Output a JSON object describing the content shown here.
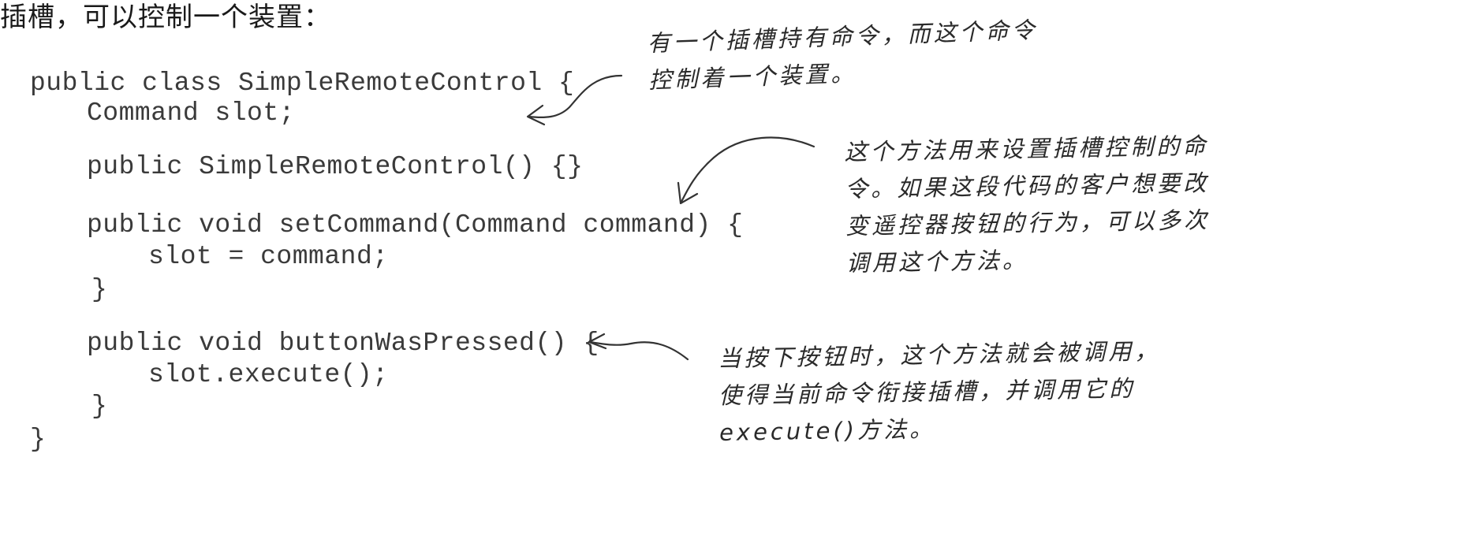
{
  "intro_text": "插槽，可以控制一个装置：",
  "code": {
    "line1": "public class SimpleRemoteControl {",
    "line2": "Command slot;",
    "line3": "public SimpleRemoteControl() {}",
    "line4": "public void setCommand(Command command) {",
    "line5": "slot = command;",
    "line6": "}",
    "line7": "public void buttonWasPressed() {",
    "line8": "slot.execute();",
    "line9": "}",
    "line10": "}"
  },
  "annotations": {
    "slot": {
      "line1": "有一个插槽持有命令，而这个命令",
      "line2": "控制着一个装置。"
    },
    "set_command": {
      "line1": "这个方法用来设置插槽控制的命",
      "line2": "令。如果这段代码的客户想要改",
      "line3": "变遥控器按钮的行为，可以多次",
      "line4": "调用这个方法。"
    },
    "button_pressed": {
      "line1": "当按下按钮时，这个方法就会被调用，",
      "line2": "使得当前命令衔接插槽，并调用它的",
      "line3": "execute()方法。"
    }
  }
}
